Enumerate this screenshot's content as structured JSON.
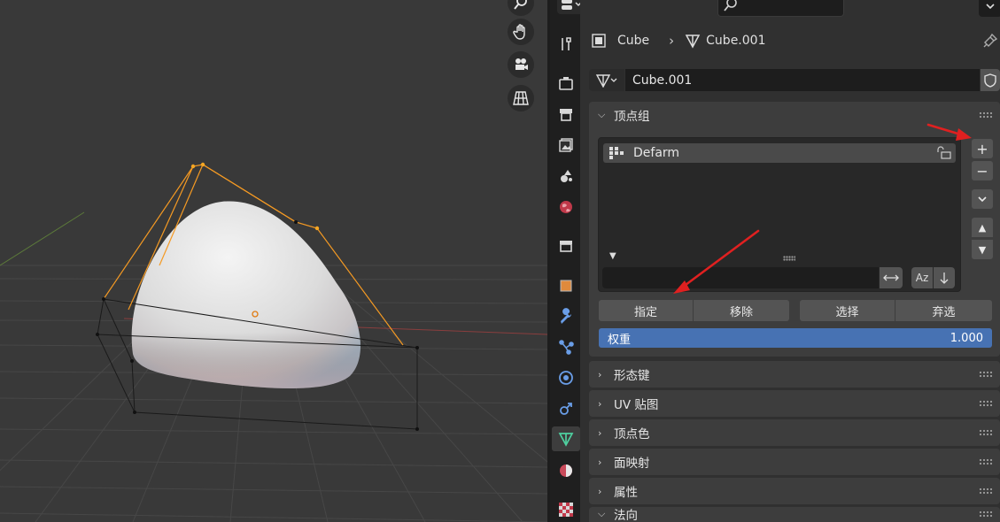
{
  "header": {
    "object_name": "Cube",
    "mesh_name": "Cube.001"
  },
  "mesh_datablock": {
    "name": "Cube.001"
  },
  "vertex_groups": {
    "title": "顶点组",
    "items": [
      {
        "name": "Defarm"
      }
    ],
    "filter_value": "",
    "buttons": {
      "assign": "指定",
      "remove": "移除",
      "select": "选择",
      "deselect": "弃选"
    },
    "weight": {
      "label": "权重",
      "value": "1.000"
    }
  },
  "panels": [
    {
      "title": "形态键"
    },
    {
      "title": "UV 贴图"
    },
    {
      "title": "顶点色"
    },
    {
      "title": "面映射"
    },
    {
      "title": "属性"
    },
    {
      "title": "法向"
    }
  ],
  "side_buttons": {
    "add": "+",
    "remove": "−",
    "specials": "chevron-down-icon",
    "up": "▲",
    "down": "▼"
  },
  "icons": {
    "viewport": [
      "zoom-icon",
      "hand-pan-icon",
      "camera-icon",
      "grid-icon"
    ],
    "tabs": [
      "tool-icon",
      "render-icon",
      "output-icon",
      "view-layer-icon",
      "scene-icon",
      "world-icon",
      "collection-icon",
      "object-icon",
      "modifier-icon",
      "particles-icon",
      "physics-icon",
      "constraints-icon",
      "mesh-data-icon",
      "material-icon",
      "texture-icon"
    ]
  },
  "colors": {
    "accent": "#4772b3",
    "selection_orange": "#f5a623",
    "annotation_red": "#e02020",
    "active_tab_icon": "#4fd0a0"
  }
}
